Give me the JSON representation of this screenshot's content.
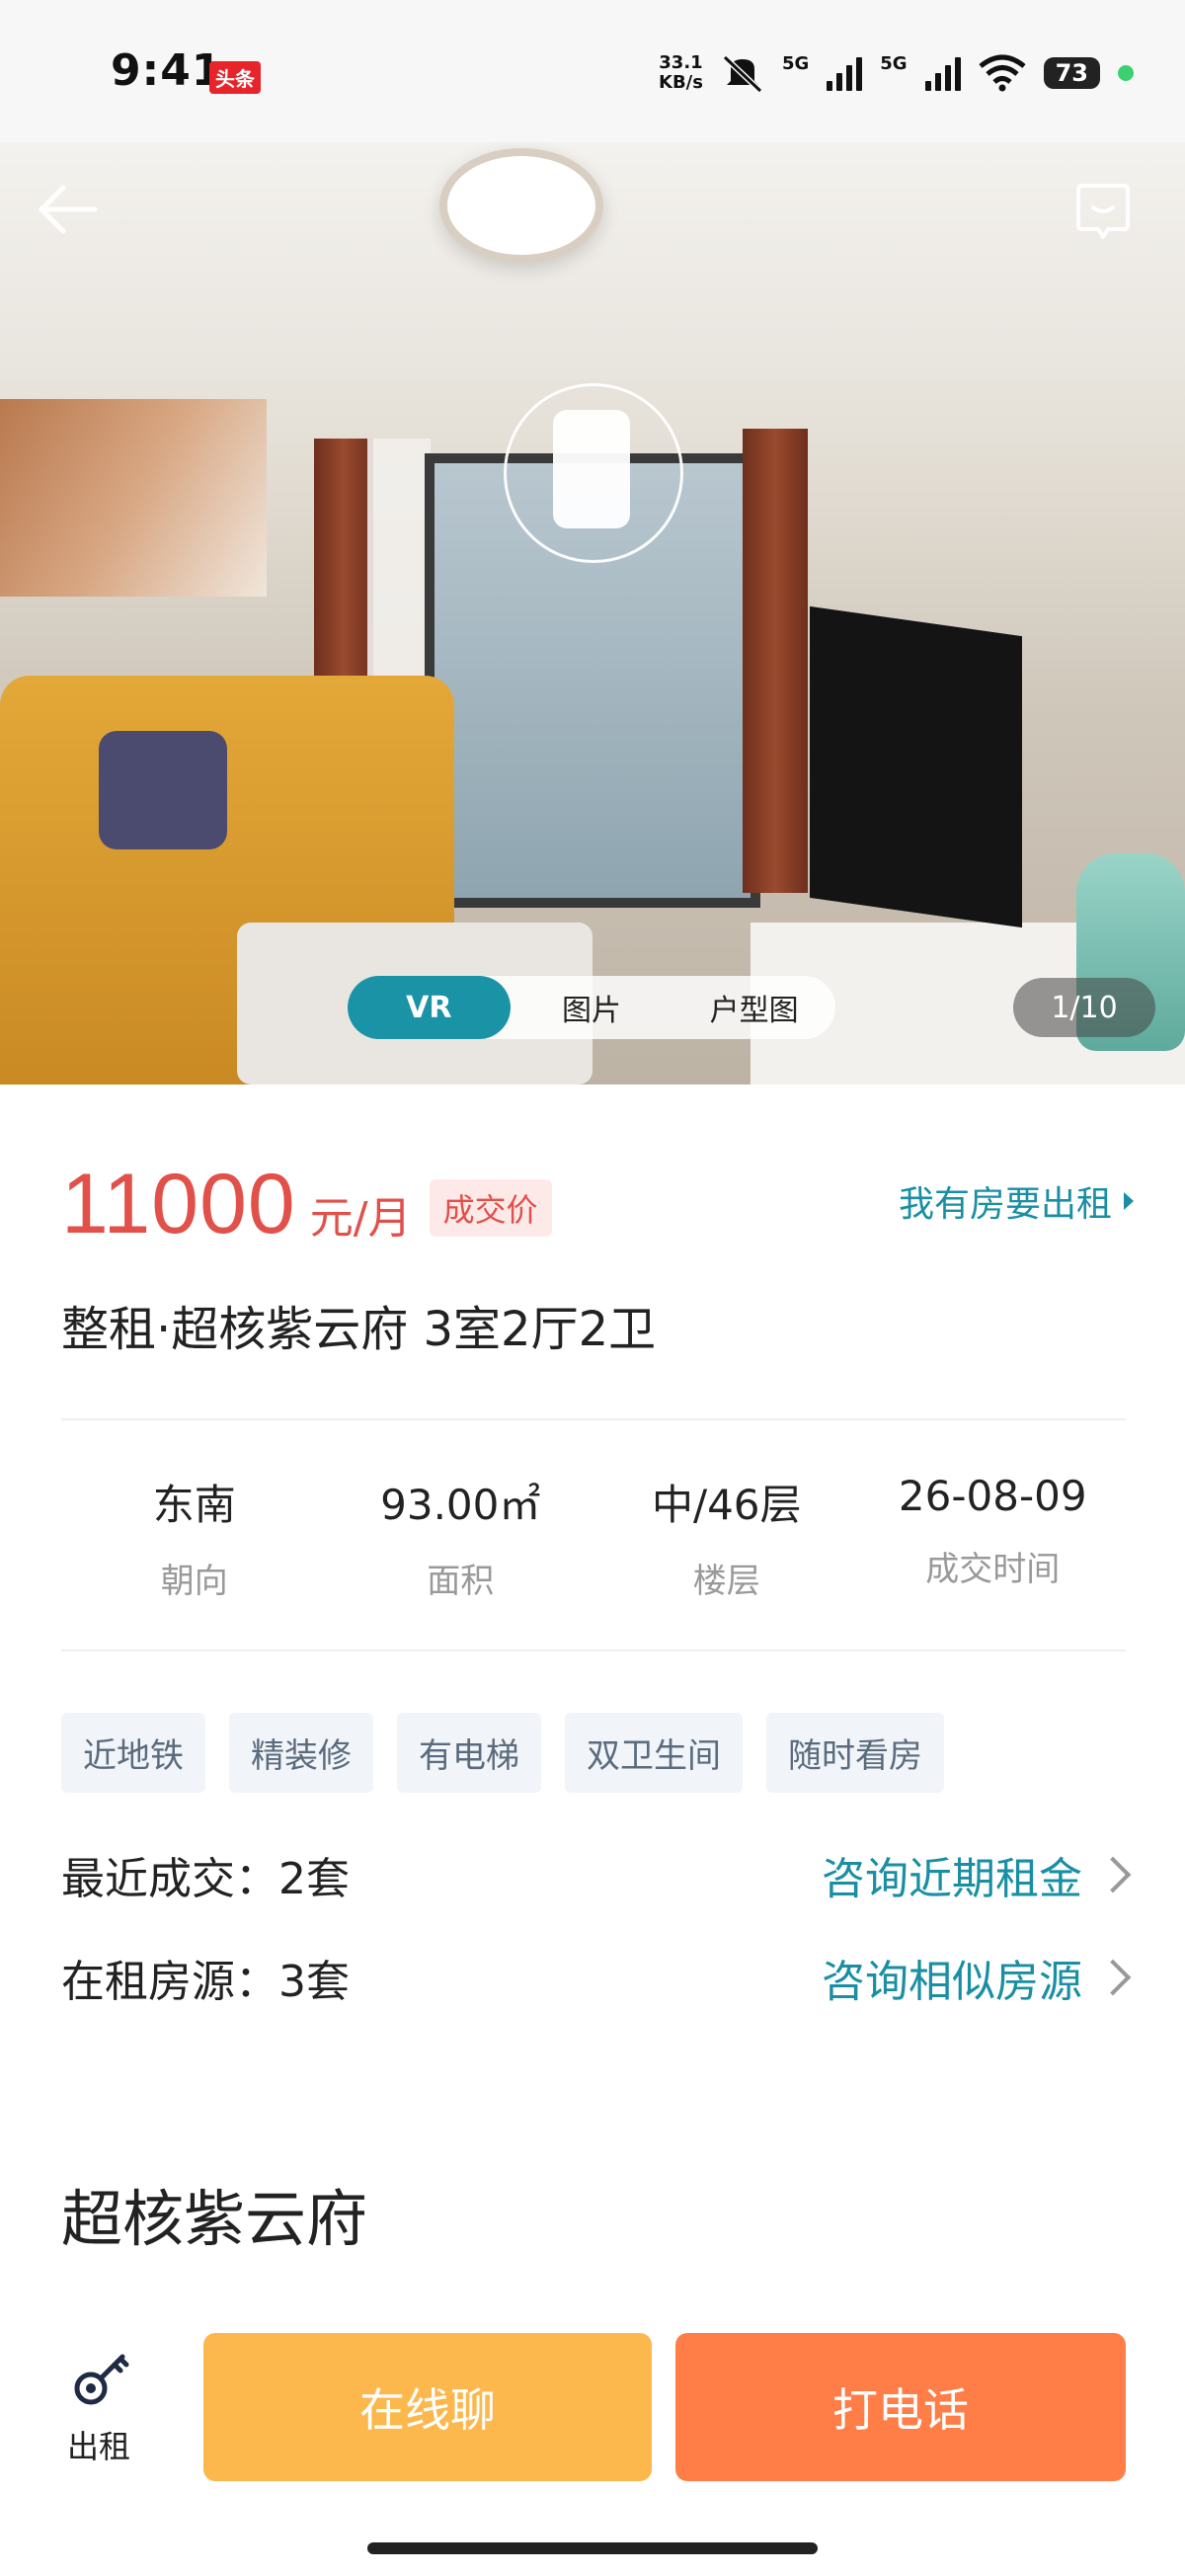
{
  "status_bar": {
    "time": "9:41",
    "badge": "头条",
    "net_speed_value": "33.1",
    "net_speed_unit": "KB/s",
    "sim1": "5G",
    "sim2": "5G",
    "battery": "73"
  },
  "hero": {
    "tabs": [
      "VR",
      "图片",
      "户型图"
    ],
    "active_tab": "VR",
    "counter": "1/10"
  },
  "listing": {
    "price": "11000",
    "price_unit": "元/月",
    "price_tag": "成交价",
    "rent_out_link": "我有房要出租",
    "title": "整租·超核紫云府 3室2厅2卫",
    "stats": [
      {
        "value": "东南",
        "label": "朝向"
      },
      {
        "value": "93.00㎡",
        "label": "面积"
      },
      {
        "value": "中/46层",
        "label": "楼层"
      },
      {
        "value": "26-08-09",
        "label": "成交时间"
      }
    ],
    "tags": [
      "近地铁",
      "精装修",
      "有电梯",
      "双卫生间",
      "随时看房"
    ],
    "recent_deals_label": "最近成交：2套",
    "recent_deals_link": "咨询近期租金",
    "on_rent_label": "在租房源：3套",
    "on_rent_link": "咨询相似房源",
    "community": "超核紫云府"
  },
  "bottom_bar": {
    "rent_label": "出租",
    "chat_button": "在线聊",
    "call_button": "打电话"
  },
  "colors": {
    "accent": "#1a93a6",
    "price": "#e2504a",
    "chat_button": "#fdb84d",
    "call_button": "#ff7d47"
  }
}
